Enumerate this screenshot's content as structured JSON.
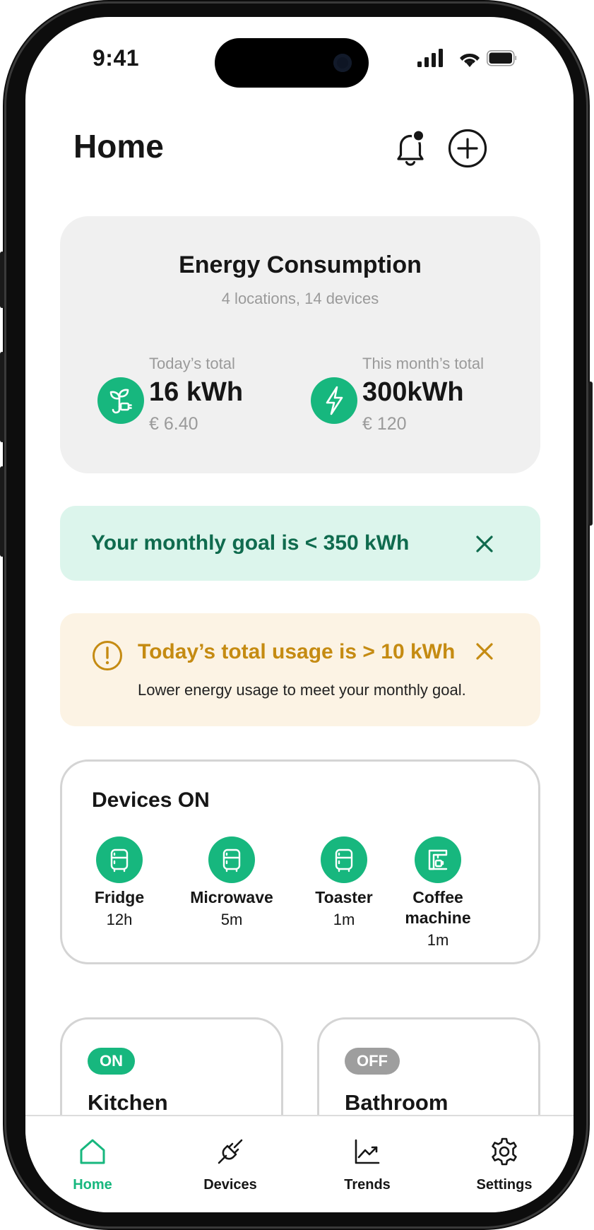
{
  "status_bar": {
    "time": "9:41"
  },
  "header": {
    "title": "Home",
    "notifications_icon": "bell-with-dot-icon",
    "add_icon": "plus-circle-icon"
  },
  "energy_card": {
    "title": "Energy Consumption",
    "subtitle": "4 locations, 14 devices",
    "today": {
      "label": "Today’s total",
      "value": "16 kWh",
      "cost": "€ 6.40",
      "icon": "plant-plug-icon"
    },
    "month": {
      "label": "This month’s total",
      "value": "300kWh",
      "cost": "€ 120",
      "icon": "lightning-icon"
    }
  },
  "goal_banner": {
    "text": "Your monthly goal is < 350 kWh"
  },
  "warning_banner": {
    "title": "Today’s total usage is > 10 kWh",
    "message": "Lower energy usage to meet your monthly goal."
  },
  "devices_on": {
    "title": "Devices ON",
    "items": [
      {
        "name": "Fridge",
        "time": "12h",
        "icon": "fridge-icon"
      },
      {
        "name": "Microwave",
        "time": "5m",
        "icon": "fridge-icon"
      },
      {
        "name": "Toaster",
        "time": "1m",
        "icon": "fridge-icon"
      },
      {
        "name": "Coffee machine",
        "time": "1m",
        "icon": "coffee-machine-icon"
      }
    ]
  },
  "rooms": [
    {
      "name": "Kitchen",
      "status": "ON"
    },
    {
      "name": "Bathroom",
      "status": "OFF"
    }
  ],
  "tabbar": {
    "items": [
      {
        "label": "Home",
        "icon": "home-icon",
        "active": true
      },
      {
        "label": "Devices",
        "icon": "plug-icon",
        "active": false
      },
      {
        "label": "Trends",
        "icon": "chart-line-icon",
        "active": false
      },
      {
        "label": "Settings",
        "icon": "gear-icon",
        "active": false
      }
    ]
  },
  "colors": {
    "accent_green": "#17b77e",
    "goal_text": "#0f6b4e",
    "goal_bg": "#dcf5ec",
    "warning_text": "#c58b12",
    "warning_bg": "#fcf3e4",
    "off_badge": "#9e9e9e"
  }
}
